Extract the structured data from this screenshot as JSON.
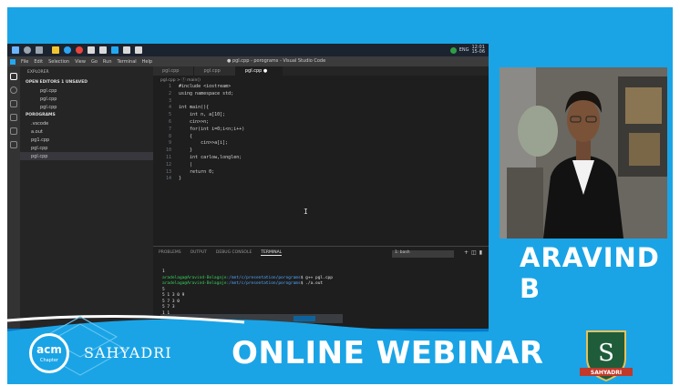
{
  "window_title": "● pgl.cpp - porograms - Visual Studio Code",
  "menu": [
    "File",
    "Edit",
    "Selection",
    "View",
    "Go",
    "Run",
    "Terminal",
    "Help"
  ],
  "system_tray": {
    "lang": "ENG",
    "time": "12:01",
    "date": "15-06"
  },
  "explorer": {
    "title": "EXPLORER",
    "open_editors": "OPEN EDITORS  1 UNSAVED",
    "open_files": [
      "pgl.cpp",
      "pgl.cpp",
      "pgl.cpp"
    ],
    "project": "POROGRAMS",
    "files": [
      ".vscode",
      "a.out",
      "pg1.cpp",
      "pgl.cpp",
      "pgl.cpp"
    ]
  },
  "tabs": [
    "pgl.cpp",
    "pgl.cpp",
    "pgl.cpp"
  ],
  "breadcrumb": "pgl.cpp > ⓕ main()",
  "code_lines": [
    "#include <iostream>",
    "using namespace std;",
    "",
    "int main(){",
    "    int n, a[10];",
    "    cin>>n;",
    "    for(int i=0;i<n;i++)",
    "    {",
    "        cin>>a[i];",
    "    }",
    "    int carlow,longlen;",
    "    |",
    "    return 0;",
    "}"
  ],
  "panel_tabs": [
    "PROBLEMS",
    "OUTPUT",
    "DEBUG CONSOLE",
    "TERMINAL"
  ],
  "terminal_select": "1: bash",
  "terminal_lines": [
    {
      "prompt": "",
      "path": "",
      "cmd": "1"
    },
    {
      "prompt": "aradelaga@Aravind-Belagaje",
      "path": ":/mnt/c/presentation/porograms",
      "cmd": "$ g++ pgl.cpp"
    },
    {
      "prompt": "aradelaga@Aravind-Belagaje",
      "path": ":/mnt/c/presentation/porograms",
      "cmd": "$ ./a.out"
    },
    {
      "prompt": "",
      "path": "",
      "cmd": "5"
    },
    {
      "prompt": "",
      "path": "",
      "cmd": "5 1 3 0 9"
    },
    {
      "prompt": "",
      "path": "",
      "cmd": "5 7 3 0"
    },
    {
      "prompt": "",
      "path": "",
      "cmd": "5 7 3"
    },
    {
      "prompt": "",
      "path": "",
      "cmd": "1 1"
    }
  ],
  "speaker_name": "ARAVIND B",
  "footer": {
    "acm_logo": "acm",
    "acm_sub": "Chapter",
    "org": "SAHYADRI",
    "title": "ONLINE WEBINAR",
    "crest_letter": "S",
    "crest_banner": "SAHYADRI"
  },
  "colors": {
    "background": "#1aa4e6",
    "editor": "#1e1e1e",
    "statusbar": "#007acc",
    "crest_green": "#1f5c3a"
  }
}
